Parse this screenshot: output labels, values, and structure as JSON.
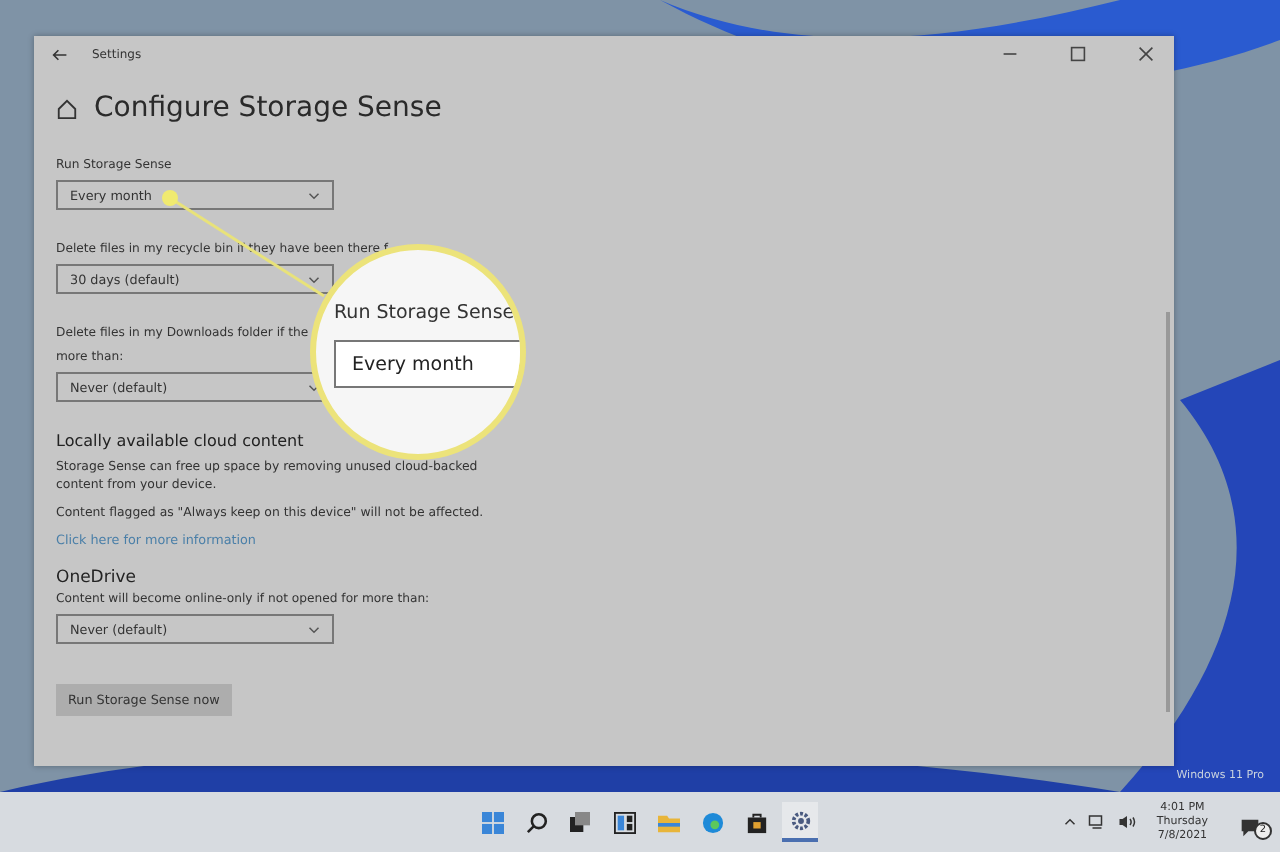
{
  "window": {
    "title": "Settings"
  },
  "page": {
    "heading": "Configure Storage Sense"
  },
  "content": [
    {
      "kind": "label",
      "text": "Run Storage Sense"
    },
    {
      "kind": "dropdown",
      "value": "Every month"
    },
    {
      "kind": "label",
      "text": "Delete files in my recycle bin if they have been there f"
    },
    {
      "kind": "dropdown",
      "value": "30 days (default)"
    },
    {
      "kind": "label",
      "text": "Delete files in my Downloads folder if the"
    },
    {
      "kind": "label",
      "text": "more than:"
    },
    {
      "kind": "dropdown",
      "value": "Never (default)"
    },
    {
      "kind": "heading",
      "text": "Locally available cloud content"
    },
    {
      "kind": "text",
      "text": "Storage Sense can free up space by removing unused cloud-backed content from your device."
    },
    {
      "kind": "text",
      "text": "Content flagged as \"Always keep on this device\" will not be affected."
    },
    {
      "kind": "link",
      "text": "Click here for more information"
    },
    {
      "kind": "heading",
      "text": "OneDrive"
    },
    {
      "kind": "label",
      "text": "Content will become online-only if not opened for more than:"
    },
    {
      "kind": "dropdown",
      "value": "Never (default)"
    },
    {
      "kind": "button",
      "text": "Run Storage Sense now"
    }
  ],
  "magnifier": {
    "label": "Run Storage Sense",
    "value": "Every month"
  },
  "desktop": {
    "watermark": "Windows 11 Pro"
  },
  "taskbar": {
    "apps": [
      {
        "kind": "start",
        "selected": false
      },
      {
        "kind": "search",
        "selected": false
      },
      {
        "kind": "task-view",
        "selected": false
      },
      {
        "kind": "widgets",
        "selected": false
      },
      {
        "kind": "folder",
        "selected": false
      },
      {
        "kind": "browser",
        "selected": false
      },
      {
        "kind": "store",
        "selected": false
      },
      {
        "kind": "settings",
        "selected": true
      }
    ],
    "time": "4:01 PM",
    "day": "Thursday",
    "date": "7/8/2021",
    "notifications": "2"
  }
}
